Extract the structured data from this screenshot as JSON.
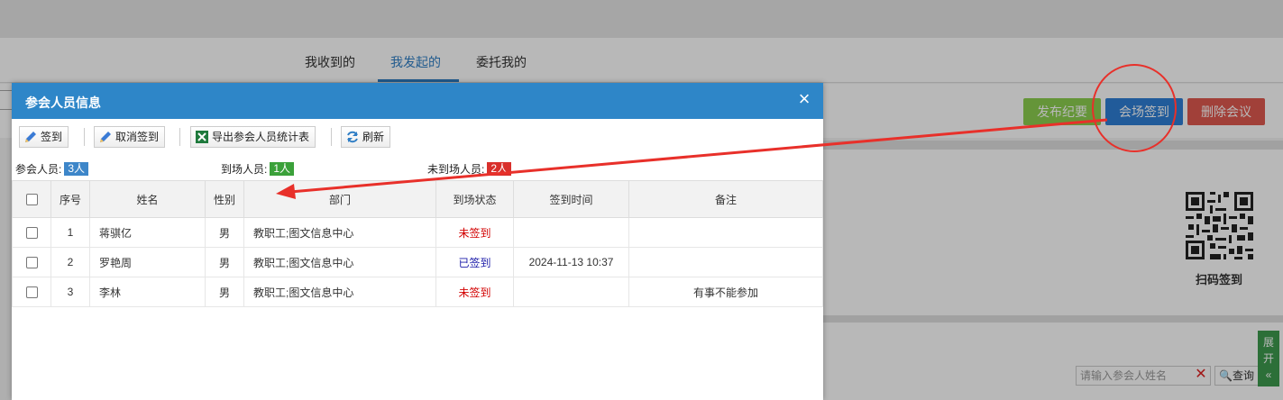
{
  "background": {
    "tabs": [
      "我收到的",
      "我发起的",
      "委托我的"
    ],
    "active_tab": 1,
    "buttons": {
      "publish": "发布纪要",
      "checkin": "会场签到",
      "delete": "删除会议"
    },
    "qr_label": "扫码签到",
    "search_placeholder": "请输入参会人姓名",
    "query_label": "查询",
    "expand_label": [
      "展",
      "开",
      "«"
    ]
  },
  "modal": {
    "title": "参会人员信息",
    "close_glyph": "×",
    "toolbar": {
      "sign": "签到",
      "cancel_sign": "取消签到",
      "export": "导出参会人员统计表",
      "refresh": "刷新"
    },
    "stats": {
      "attendees_label": "参会人员:",
      "attendees_value": "3人",
      "arrived_label": "到场人员:",
      "arrived_value": "1人",
      "absent_label": "未到场人员:",
      "absent_value": "2人"
    },
    "columns": [
      "序号",
      "姓名",
      "性别",
      "部门",
      "到场状态",
      "签到时间",
      "备注"
    ],
    "rows": [
      {
        "no": "1",
        "name": "蒋骐亿",
        "gender": "男",
        "dept": "教职工;图文信息中心",
        "status": "未签到",
        "time": "",
        "note": ""
      },
      {
        "no": "2",
        "name": "罗艳周",
        "gender": "男",
        "dept": "教职工;图文信息中心",
        "status": "已签到",
        "time": "2024-11-13 10:37",
        "note": ""
      },
      {
        "no": "3",
        "name": "李林",
        "gender": "男",
        "dept": "教职工;图文信息中心",
        "status": "未签到",
        "time": "",
        "note": "有事不能参加"
      }
    ]
  },
  "colors": {
    "header_blue": "#2e86c8",
    "annotation_red": "#e8302a",
    "not_signed": "#d20000",
    "signed": "#1a1aa8"
  }
}
